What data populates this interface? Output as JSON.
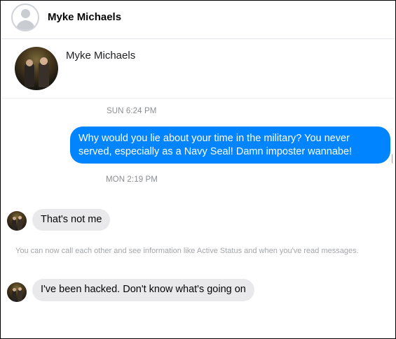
{
  "header": {
    "contact_name": "Myke Michaels",
    "avatar_icon": "default-user-avatar-icon"
  },
  "profile": {
    "name": "Myke Michaels",
    "avatar_icon": "profile-photo"
  },
  "conversation": {
    "groups": [
      {
        "timestamp": "SUN 6:24 PM",
        "messages": [
          {
            "direction": "outgoing",
            "lines": [
              "Why would you lie about your time in the military?  You never",
              "served, especially as a Navy Seal!  Damn imposter wannabe!"
            ]
          }
        ]
      },
      {
        "timestamp": "MON 2:19 PM",
        "messages": [
          {
            "direction": "incoming",
            "text": "That's not me"
          }
        ]
      }
    ],
    "system_notice": "You can now call each other and see information like Active Status and when you've read messages.",
    "after_notice": [
      {
        "direction": "incoming",
        "text": "I've been hacked. Don't know what's going on"
      }
    ]
  },
  "colors": {
    "outgoing_bubble": "#0084ff",
    "incoming_bubble": "#e9e9eb",
    "timestamp_text": "#8a8d91",
    "notice_text": "#a3a6aa"
  }
}
